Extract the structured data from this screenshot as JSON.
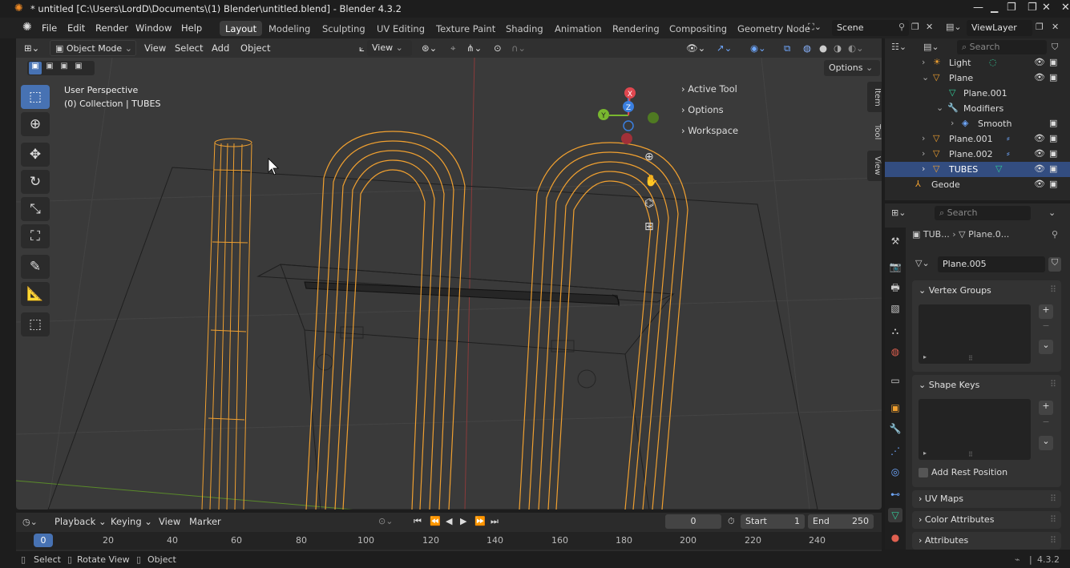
{
  "title_bar": {
    "title": "* untitled [C:\\Users\\LordD\\Documents\\(1) Blender\\untitled.blend] - Blender 4.3.2"
  },
  "menu": {
    "items": [
      "File",
      "Edit",
      "Render",
      "Window",
      "Help"
    ],
    "workspaces": [
      "Layout",
      "Modeling",
      "Sculpting",
      "UV Editing",
      "Texture Paint",
      "Shading",
      "Animation",
      "Rendering",
      "Compositing",
      "Geometry Node"
    ],
    "active_workspace": "Layout",
    "scene": "Scene",
    "view_layer": "ViewLayer"
  },
  "viewport_header": {
    "mode": "Object Mode",
    "menus": [
      "View",
      "Select",
      "Add",
      "Object"
    ],
    "transform_orientation": "View",
    "options_label": "Options"
  },
  "viewport": {
    "perspective_label": "User Perspective",
    "collection_label": "(0) Collection | TUBES",
    "gizmo_axes": [
      "X",
      "Y",
      "Z"
    ],
    "npanel_items": [
      "Active Tool",
      "Options",
      "Workspace"
    ],
    "npanel_tabs": [
      "Item",
      "Tool",
      "View"
    ]
  },
  "outliner": {
    "search_placeholder": "Search",
    "rows": [
      {
        "label": "Light",
        "icon": "light-icon"
      },
      {
        "label": "Plane",
        "icon": "mesh-object-icon"
      },
      {
        "label": "Plane.001",
        "icon": "mesh-data-icon"
      },
      {
        "label": "Modifiers",
        "icon": "wrench-icon"
      },
      {
        "label": "Smooth",
        "icon": "smooth-modifier-icon"
      },
      {
        "label": "Plane.001",
        "icon": "mesh-object-icon"
      },
      {
        "label": "Plane.002",
        "icon": "mesh-object-icon"
      },
      {
        "label": "TUBES",
        "icon": "mesh-object-icon",
        "selected": true
      },
      {
        "label": "Geode",
        "icon": "armature-icon"
      }
    ]
  },
  "properties": {
    "search_placeholder": "Search",
    "breadcrumb_object": "TUB...",
    "breadcrumb_data": "Plane.0...",
    "mesh_name": "Plane.005",
    "panels": [
      "Vertex Groups",
      "Shape Keys"
    ],
    "add_rest_position": "Add Rest Position",
    "collapsed_panels": [
      "UV Maps",
      "Color Attributes",
      "Attributes"
    ]
  },
  "timeline": {
    "menus": [
      "Playback",
      "Keying",
      "View",
      "Marker"
    ],
    "current_frame": "0",
    "start_label": "Start",
    "start_value": "1",
    "end_label": "End",
    "end_value": "250",
    "frame_markers": [
      "0",
      "20",
      "40",
      "60",
      "80",
      "100",
      "120",
      "140",
      "160",
      "180",
      "200",
      "220",
      "240"
    ]
  },
  "status_bar": {
    "items": [
      "Select",
      "Rotate View",
      "Object"
    ],
    "version": "4.3.2"
  },
  "colors": {
    "accent": "#4772b3",
    "selection_orange": "#f0a030",
    "viewport_bg": "#3a3a3a",
    "x_axis": "#e0474f",
    "y_axis": "#79b72f",
    "z_axis": "#3a7fe0"
  }
}
